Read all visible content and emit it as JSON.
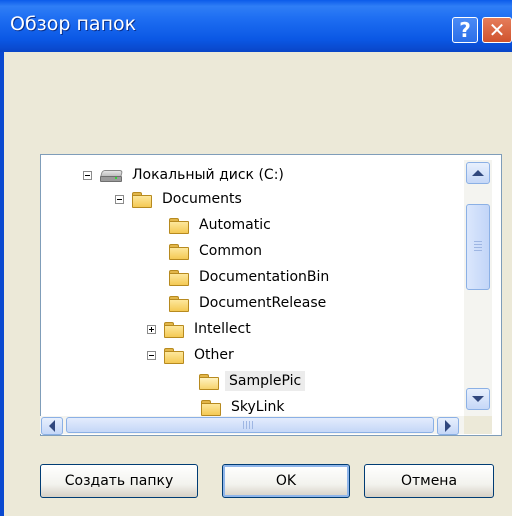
{
  "window": {
    "title": "Обзор папок",
    "help_glyph": "?",
    "close_glyph": "✕"
  },
  "tree": {
    "items": [
      {
        "label": "Локальный диск (C:)",
        "icon": "hard-drive-icon",
        "expander": "collapse"
      },
      {
        "label": "Documents",
        "icon": "folder-icon",
        "expander": "collapse"
      },
      {
        "label": "Automatic",
        "icon": "folder-icon",
        "expander": ""
      },
      {
        "label": "Common",
        "icon": "folder-icon",
        "expander": ""
      },
      {
        "label": "DocumentationBin",
        "icon": "folder-icon",
        "expander": ""
      },
      {
        "label": "DocumentRelease",
        "icon": "folder-icon",
        "expander": ""
      },
      {
        "label": "Intellect",
        "icon": "folder-icon",
        "expander": "expand"
      },
      {
        "label": "Other",
        "icon": "folder-icon",
        "expander": "collapse"
      },
      {
        "label": "SamplePic",
        "icon": "folder-open-icon",
        "expander": "",
        "selected": true
      },
      {
        "label": "SkyLink",
        "icon": "folder-icon",
        "expander": ""
      }
    ]
  },
  "buttons": {
    "new_folder": "Создать папку",
    "ok": "OK",
    "cancel": "Отмена"
  },
  "colors": {
    "titlebar": "#0b58e5",
    "dialog_bg": "#ece9d8",
    "close_button": "#d0532d"
  }
}
